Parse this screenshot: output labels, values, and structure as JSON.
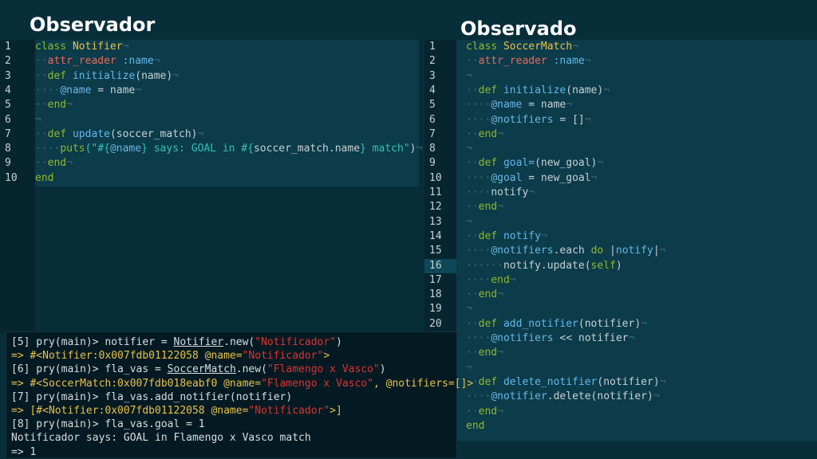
{
  "titles": {
    "left": "Observador",
    "right": "Observado"
  },
  "editor_left": {
    "lines": [
      [
        {
          "t": "class ",
          "c": "kw"
        },
        {
          "t": "Notifier",
          "c": "cls"
        },
        {
          "t": "¬",
          "c": "ws"
        }
      ],
      [
        {
          "t": "··",
          "c": "ws"
        },
        {
          "t": "attr_reader ",
          "c": "sym"
        },
        {
          "t": ":name",
          "c": "fn"
        },
        {
          "t": "¬",
          "c": "ws"
        }
      ],
      [
        {
          "t": "··",
          "c": "ws"
        },
        {
          "t": "def ",
          "c": "kw"
        },
        {
          "t": "initialize",
          "c": "fn"
        },
        {
          "t": "(name)",
          "c": "txt"
        },
        {
          "t": "¬",
          "c": "ws"
        }
      ],
      [
        {
          "t": "····",
          "c": "ws"
        },
        {
          "t": "@name",
          "c": "ivar"
        },
        {
          "t": " = name",
          "c": "txt"
        },
        {
          "t": "¬",
          "c": "ws"
        }
      ],
      [
        {
          "t": "··",
          "c": "ws"
        },
        {
          "t": "end",
          "c": "kw"
        },
        {
          "t": "¬",
          "c": "ws"
        }
      ],
      [
        {
          "t": "¬",
          "c": "ws"
        }
      ],
      [
        {
          "t": "··",
          "c": "ws"
        },
        {
          "t": "def ",
          "c": "kw"
        },
        {
          "t": "update",
          "c": "fn"
        },
        {
          "t": "(soccer_match)",
          "c": "txt"
        },
        {
          "t": "¬",
          "c": "ws"
        }
      ],
      [
        {
          "t": "····",
          "c": "ws"
        },
        {
          "t": "puts",
          "c": "kw"
        },
        {
          "t": "(\"#{",
          "c": "str"
        },
        {
          "t": "@name",
          "c": "ivar"
        },
        {
          "t": "} says: GOAL in #{",
          "c": "str"
        },
        {
          "t": "soccer_match.name",
          "c": "txt"
        },
        {
          "t": "} match\"",
          "c": "str"
        },
        {
          "t": ")",
          "c": "txt"
        },
        {
          "t": "¬",
          "c": "ws"
        }
      ],
      [
        {
          "t": "··",
          "c": "ws"
        },
        {
          "t": "end",
          "c": "kw"
        },
        {
          "t": "¬",
          "c": "ws"
        }
      ],
      [
        {
          "t": "end",
          "c": "kw"
        }
      ]
    ]
  },
  "editor_right": {
    "current_line": 16,
    "lines": [
      [
        {
          "t": "class ",
          "c": "kw"
        },
        {
          "t": "SoccerMatch",
          "c": "cls"
        },
        {
          "t": "¬",
          "c": "ws"
        }
      ],
      [
        {
          "t": "··",
          "c": "ws"
        },
        {
          "t": "attr_reader ",
          "c": "sym"
        },
        {
          "t": ":name",
          "c": "fn"
        },
        {
          "t": "¬",
          "c": "ws"
        }
      ],
      [
        {
          "t": "¬",
          "c": "ws"
        }
      ],
      [
        {
          "t": "··",
          "c": "ws"
        },
        {
          "t": "def ",
          "c": "kw"
        },
        {
          "t": "initialize",
          "c": "fn"
        },
        {
          "t": "(name)",
          "c": "txt"
        },
        {
          "t": "¬",
          "c": "ws"
        }
      ],
      [
        {
          "t": "····",
          "c": "ws"
        },
        {
          "t": "@name",
          "c": "ivar"
        },
        {
          "t": " = name",
          "c": "txt"
        },
        {
          "t": "¬",
          "c": "ws"
        }
      ],
      [
        {
          "t": "····",
          "c": "ws"
        },
        {
          "t": "@notifiers",
          "c": "ivar"
        },
        {
          "t": " = []",
          "c": "txt"
        },
        {
          "t": "¬",
          "c": "ws"
        }
      ],
      [
        {
          "t": "··",
          "c": "ws"
        },
        {
          "t": "end",
          "c": "kw"
        },
        {
          "t": "¬",
          "c": "ws"
        }
      ],
      [
        {
          "t": "¬",
          "c": "ws"
        }
      ],
      [
        {
          "t": "··",
          "c": "ws"
        },
        {
          "t": "def ",
          "c": "kw"
        },
        {
          "t": "goal=",
          "c": "fn"
        },
        {
          "t": "(new_goal)",
          "c": "txt"
        },
        {
          "t": "¬",
          "c": "ws"
        }
      ],
      [
        {
          "t": "····",
          "c": "ws"
        },
        {
          "t": "@goal",
          "c": "ivar"
        },
        {
          "t": " = new_goal",
          "c": "txt"
        },
        {
          "t": "¬",
          "c": "ws"
        }
      ],
      [
        {
          "t": "····",
          "c": "ws"
        },
        {
          "t": "notify",
          "c": "txt"
        },
        {
          "t": "¬",
          "c": "ws"
        }
      ],
      [
        {
          "t": "··",
          "c": "ws"
        },
        {
          "t": "end",
          "c": "kw"
        },
        {
          "t": "¬",
          "c": "ws"
        }
      ],
      [
        {
          "t": "¬",
          "c": "ws"
        }
      ],
      [
        {
          "t": "··",
          "c": "ws"
        },
        {
          "t": "def ",
          "c": "kw"
        },
        {
          "t": "notify",
          "c": "fn"
        },
        {
          "t": "¬",
          "c": "ws"
        }
      ],
      [
        {
          "t": "····",
          "c": "ws"
        },
        {
          "t": "@notifiers",
          "c": "ivar"
        },
        {
          "t": ".each ",
          "c": "txt"
        },
        {
          "t": "do ",
          "c": "kw"
        },
        {
          "t": "|",
          "c": "txt"
        },
        {
          "t": "notify",
          "c": "fn"
        },
        {
          "t": "|",
          "c": "txt"
        },
        {
          "t": "¬",
          "c": "ws"
        }
      ],
      [
        {
          "t": "······",
          "c": "ws"
        },
        {
          "t": "notify.update(",
          "c": "txt"
        },
        {
          "t": "self",
          "c": "kw"
        },
        {
          "t": ")",
          "c": "txt"
        }
      ],
      [
        {
          "t": "····",
          "c": "ws"
        },
        {
          "t": "end",
          "c": "kw"
        },
        {
          "t": "¬",
          "c": "ws"
        }
      ],
      [
        {
          "t": "··",
          "c": "ws"
        },
        {
          "t": "end",
          "c": "kw"
        },
        {
          "t": "¬",
          "c": "ws"
        }
      ],
      [
        {
          "t": "¬",
          "c": "ws"
        }
      ],
      [
        {
          "t": "··",
          "c": "ws"
        },
        {
          "t": "def ",
          "c": "kw"
        },
        {
          "t": "add_notifier",
          "c": "fn"
        },
        {
          "t": "(notifier)",
          "c": "txt"
        },
        {
          "t": "¬",
          "c": "ws"
        }
      ],
      [
        {
          "t": "····",
          "c": "ws"
        },
        {
          "t": "@notifiers",
          "c": "ivar"
        },
        {
          "t": " << notifier",
          "c": "txt"
        },
        {
          "t": "¬",
          "c": "ws"
        }
      ],
      [
        {
          "t": "··",
          "c": "ws"
        },
        {
          "t": "end",
          "c": "kw"
        },
        {
          "t": "¬",
          "c": "ws"
        }
      ],
      [
        {
          "t": "¬",
          "c": "ws"
        }
      ],
      [
        {
          "t": "··",
          "c": "ws"
        },
        {
          "t": "def ",
          "c": "kw"
        },
        {
          "t": "delete_notifier",
          "c": "fn"
        },
        {
          "t": "(notifier)",
          "c": "txt"
        },
        {
          "t": "¬",
          "c": "ws"
        }
      ],
      [
        {
          "t": "····",
          "c": "ws"
        },
        {
          "t": "@notifier",
          "c": "ivar"
        },
        {
          "t": ".delete(notifier)",
          "c": "txt"
        },
        {
          "t": "¬",
          "c": "ws"
        }
      ],
      [
        {
          "t": "··",
          "c": "ws"
        },
        {
          "t": "end",
          "c": "kw"
        },
        {
          "t": "¬",
          "c": "ws"
        }
      ],
      [
        {
          "t": "end",
          "c": "kw"
        }
      ]
    ],
    "visible_line_numbers": 20
  },
  "terminal": {
    "lines": [
      [
        {
          "t": "[5] pry(main)> notifier = ",
          "c": "t-prompt"
        },
        {
          "t": "Notifier",
          "c": "t-cls"
        },
        {
          "t": ".new(",
          "c": "t-prompt"
        },
        {
          "t": "\"Notificador\"",
          "c": "t-red"
        },
        {
          "t": ")",
          "c": "t-prompt"
        }
      ],
      [
        {
          "t": "=> #<Notifier:0x007fdb01122058 @name=",
          "c": "t-obj"
        },
        {
          "t": "\"Notificador\"",
          "c": "t-red"
        },
        {
          "t": ">",
          "c": "t-obj"
        }
      ],
      [
        {
          "t": "[6] pry(main)> fla_vas = ",
          "c": "t-prompt"
        },
        {
          "t": "SoccerMatch",
          "c": "t-cls"
        },
        {
          "t": ".new(",
          "c": "t-prompt"
        },
        {
          "t": "\"Flamengo x Vasco\"",
          "c": "t-red"
        },
        {
          "t": ")",
          "c": "t-prompt"
        }
      ],
      [
        {
          "t": "=> #<SoccerMatch:0x007fdb018eabf0 @name=",
          "c": "t-obj"
        },
        {
          "t": "\"Flamengo x Vasco\"",
          "c": "t-red"
        },
        {
          "t": ", @notifiers=[]>",
          "c": "t-obj"
        }
      ],
      [
        {
          "t": "[7] pry(main)> fla_vas.add_notifier(notifier)",
          "c": "t-prompt"
        }
      ],
      [
        {
          "t": "=> [#<Notifier:0x007fdb01122058 @name=",
          "c": "t-obj"
        },
        {
          "t": "\"Notificador\"",
          "c": "t-red"
        },
        {
          "t": ">]",
          "c": "t-obj"
        }
      ],
      [
        {
          "t": "[8] pry(main)> fla_vas.goal = 1",
          "c": "t-prompt"
        }
      ],
      [
        {
          "t": "Notificador says: GOAL in Flamengo x Vasco match",
          "c": "t-prompt"
        }
      ],
      [
        {
          "t": "=> 1",
          "c": "t-prompt"
        }
      ]
    ]
  },
  "colors": {
    "background": "#082e3a",
    "keyword": "#8fb82a",
    "class_name": "#e8c24a",
    "method": "#63b8ea",
    "string": "#2ec4b6",
    "terminal_string": "#e0322e"
  }
}
